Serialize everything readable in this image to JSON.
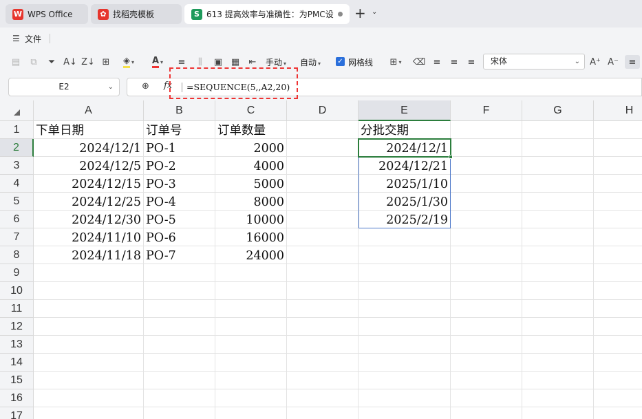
{
  "tabs": [
    {
      "label": "WPS Office",
      "icon": "wps-logo-icon",
      "color": "#e6362e"
    },
    {
      "label": "找稻壳模板",
      "icon": "docer-icon",
      "color": "#e6362e"
    },
    {
      "label": "613 提高效率与准确性：为PMC设",
      "icon": "spreadsheet-s-icon",
      "color": "#1e9a5b"
    }
  ],
  "menu": {
    "file_label": "文件"
  },
  "toolbar": {
    "manual_label": "手动",
    "auto_label": "自动",
    "gridlines_label": "网格线",
    "gridlines_checked": true,
    "font_name": "宋体"
  },
  "formula_bar": {
    "name_box": "E2",
    "formula": "=SEQUENCE(5,,A2,20)"
  },
  "columns": [
    "A",
    "B",
    "C",
    "D",
    "E",
    "F",
    "G",
    "H"
  ],
  "rows": [
    "1",
    "2",
    "3",
    "4",
    "5",
    "6",
    "7",
    "8",
    "9",
    "10",
    "11",
    "12",
    "13",
    "14",
    "15",
    "16",
    "17"
  ],
  "cells": {
    "A1": "下单日期",
    "B1": "订单号",
    "C1": "订单数量",
    "E1": "分批交期",
    "A2": "2024/12/1",
    "B2": "PO-1",
    "C2": "2000",
    "E2": "2024/12/1",
    "A3": "2024/12/5",
    "B3": "PO-2",
    "C3": "4000",
    "E3": "2024/12/21",
    "A4": "2024/12/15",
    "B4": "PO-3",
    "C4": "5000",
    "E4": "2025/1/10",
    "A5": "2024/12/25",
    "B5": "PO-4",
    "C5": "8000",
    "E5": "2025/1/30",
    "A6": "2024/12/30",
    "B6": "PO-5",
    "C6": "10000",
    "E6": "2025/2/19",
    "A7": "2024/11/10",
    "B7": "PO-6",
    "C7": "16000",
    "A8": "2024/11/18",
    "B8": "PO-7",
    "C8": "24000"
  },
  "selected_cell": "E2"
}
